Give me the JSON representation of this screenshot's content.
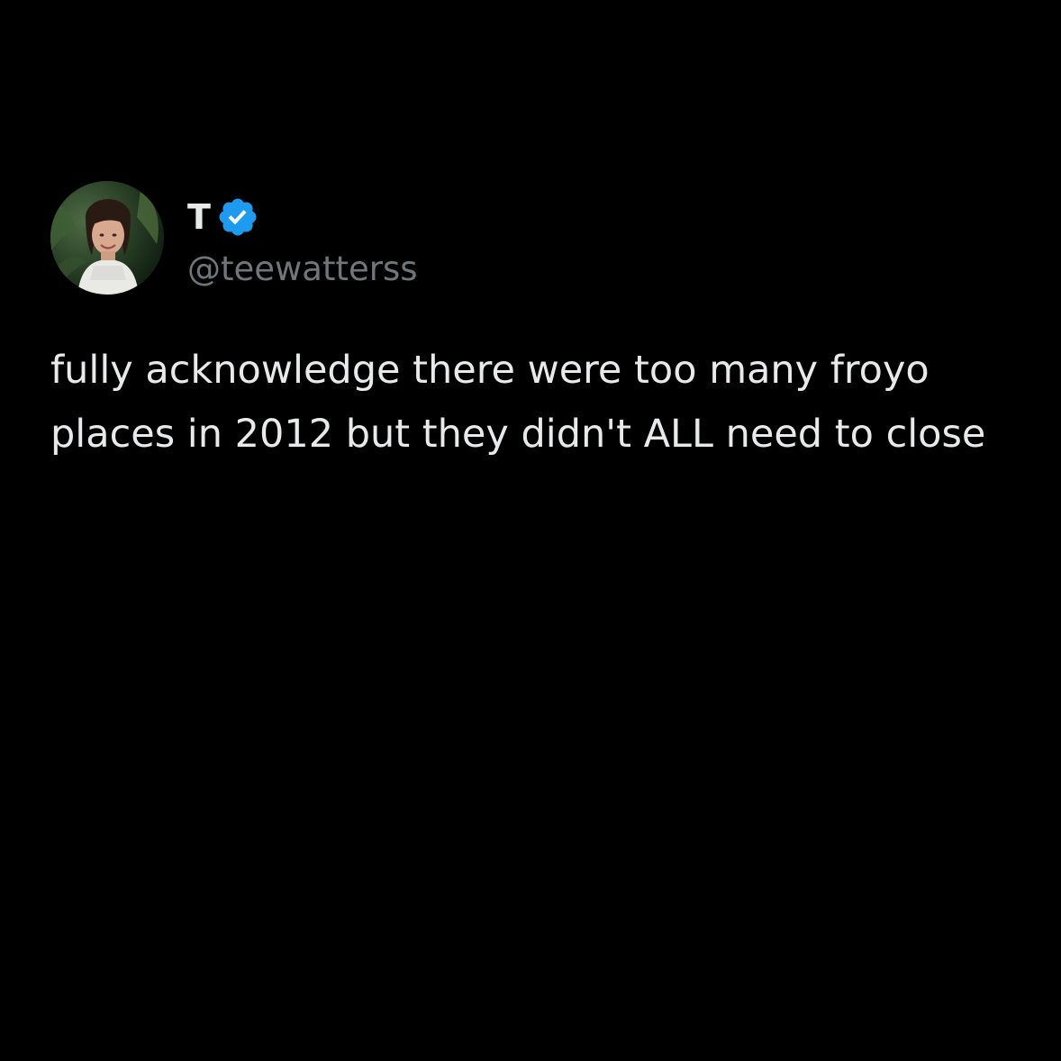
{
  "tweet": {
    "author": {
      "display_name": "T",
      "handle": "@teewatterss",
      "verified": true,
      "avatar_icon": "profile-photo"
    },
    "text": "fully acknowledge there were too many froyo places in 2012 but they didn't ALL need to close"
  },
  "colors": {
    "background": "#000000",
    "primary_text": "#e7e9ea",
    "secondary_text": "#71767b",
    "verified_badge": "#1d9bf0"
  }
}
